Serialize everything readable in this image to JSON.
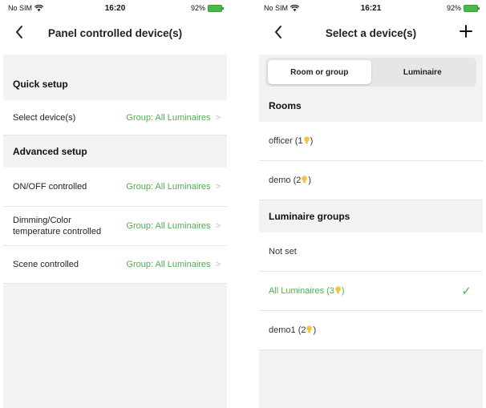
{
  "left_screen": {
    "status": {
      "carrier": "No SIM",
      "time": "16:20",
      "battery": "92%"
    },
    "nav": {
      "title": "Panel controlled device(s)",
      "back_glyph": "‹"
    },
    "quick_setup": {
      "header": "Quick setup",
      "rows": [
        {
          "label": "Select device(s)",
          "value": "Group: All Luminaires"
        }
      ]
    },
    "advanced_setup": {
      "header": "Advanced setup",
      "rows": [
        {
          "label": "ON/OFF controlled",
          "value": "Group: All Luminaires"
        },
        {
          "label": "Dimming/Color temperature controlled",
          "value": "Group: All Luminaires"
        },
        {
          "label": "Scene controlled",
          "value": "Group: All Luminaires"
        }
      ]
    },
    "chevron": ">"
  },
  "right_screen": {
    "status": {
      "carrier": "No SIM",
      "time": "16:21",
      "battery": "92%"
    },
    "nav": {
      "title": "Select a device(s)",
      "back_glyph": "‹",
      "add_glyph": "+"
    },
    "segments": [
      {
        "label": "Room or group",
        "active": true
      },
      {
        "label": "Luminaire",
        "active": false
      }
    ],
    "rooms": {
      "header": "Rooms",
      "items": [
        {
          "name": "officer (1",
          "suffix": ")"
        },
        {
          "name": "demo (2",
          "suffix": ")"
        }
      ]
    },
    "groups": {
      "header": "Luminaire groups",
      "items": [
        {
          "name": "Not set",
          "suffix": ""
        },
        {
          "name": "All Luminaires (3",
          "suffix": ")"
        },
        {
          "name": "demo1 (2",
          "suffix": ")"
        }
      ]
    },
    "check_glyph": "✓"
  },
  "colors": {
    "accent_green": "#4caf50",
    "bulb_yellow": "#f4c542",
    "background_gray": "#f2f2f2"
  },
  "icons": [
    "wifi-icon",
    "battery-icon",
    "back-chevron-icon",
    "chevron-right-icon",
    "plus-icon",
    "bulb-icon",
    "check-icon"
  ]
}
